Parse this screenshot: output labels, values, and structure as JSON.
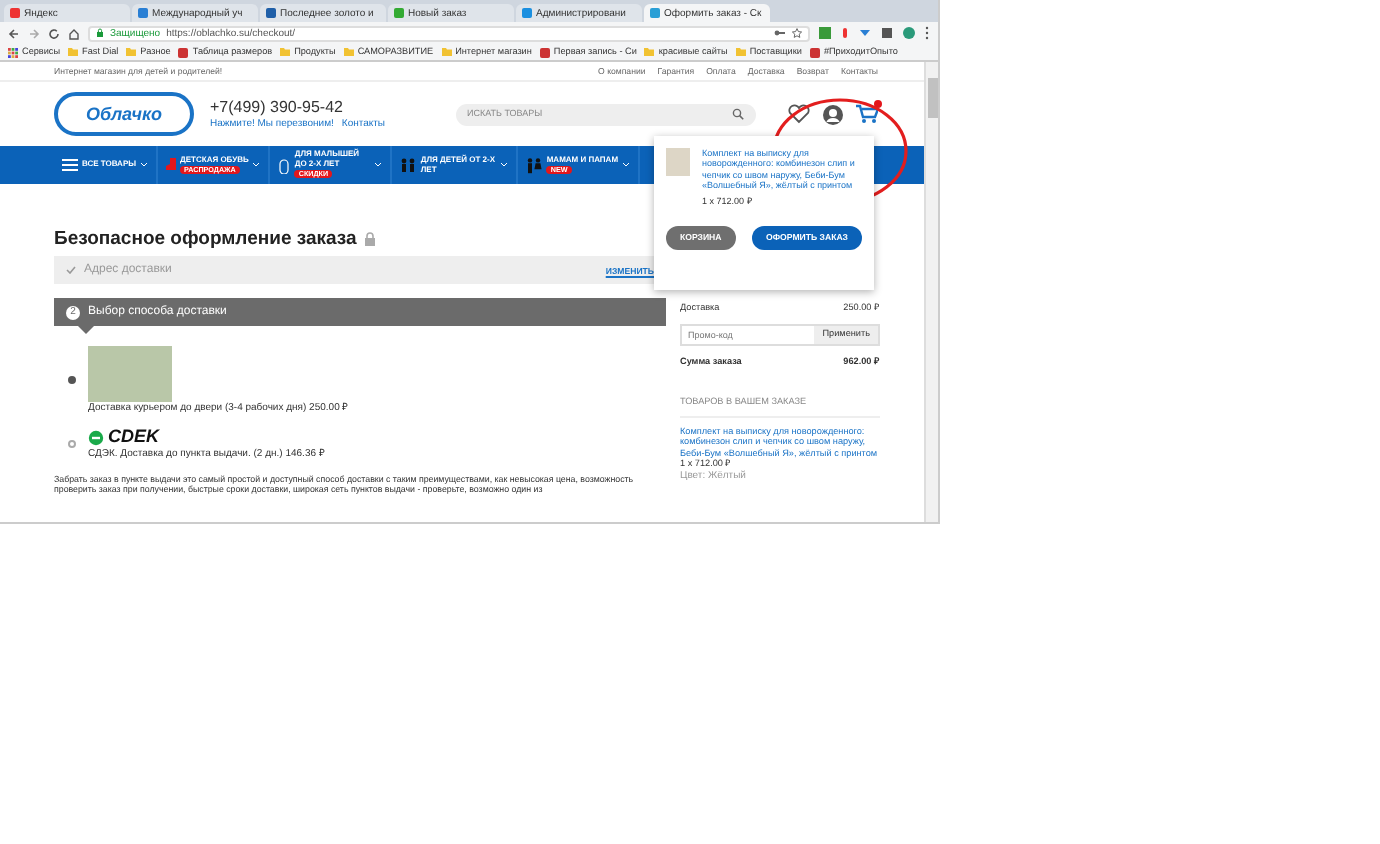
{
  "browser": {
    "tabs": [
      {
        "label": "Яндекс",
        "selected": false
      },
      {
        "label": "Международный уч",
        "selected": false
      },
      {
        "label": "Последнее золото и",
        "selected": false
      },
      {
        "label": "Новый заказ",
        "selected": false
      },
      {
        "label": "Администрировани",
        "selected": false
      },
      {
        "label": "Оформить заказ - Ск",
        "selected": true
      }
    ],
    "secure_label": "Защищено",
    "url": "https://oblachko.su/checkout/",
    "bookmarks": [
      {
        "label": "Сервисы",
        "kind": "apps"
      },
      {
        "label": "Fast Dial",
        "kind": "folder"
      },
      {
        "label": "Разное",
        "kind": "folder"
      },
      {
        "label": "Таблица размеров",
        "kind": "site"
      },
      {
        "label": "Продукты",
        "kind": "folder"
      },
      {
        "label": "САМОРАЗВИТИЕ",
        "kind": "folder"
      },
      {
        "label": "Интернет магазин",
        "kind": "folder"
      },
      {
        "label": "Первая запись - Си",
        "kind": "site"
      },
      {
        "label": "красивые сайты",
        "kind": "folder"
      },
      {
        "label": "Поставщики",
        "kind": "folder"
      },
      {
        "label": "#ПриходитОпыто",
        "kind": "site"
      }
    ]
  },
  "site": {
    "tagline": "Интернет магазин для детей и родителей!",
    "top_links": [
      "О компании",
      "Гарантия",
      "Оплата",
      "Доставка",
      "Возврат",
      "Контакты"
    ],
    "logo": "Облачко",
    "phone": "+7(499) 390-95-42",
    "callback": "Нажмите! Мы перезвоним!",
    "contacts": "Контакты",
    "search": {
      "placeholder": "ИСКАТЬ ТОВАРЫ"
    },
    "nav": [
      {
        "label": "ВСЕ ТОВАРЫ",
        "kind": "menu"
      },
      {
        "label": "ДЕТСКАЯ ОБУВЬ",
        "badge": "РАСПРОДАЖА",
        "kind": "boot"
      },
      {
        "label": "ДЛЯ МАЛЫШЕЙ ДО 2-Х ЛЕТ",
        "badge": "СКИДКИ",
        "kind": "bottle"
      },
      {
        "label": "ДЛЯ ДЕТЕЙ ОТ 2-Х ЛЕТ",
        "kind": "kids"
      },
      {
        "label": "МАМАМ И ПАПАМ",
        "badge": "NEW",
        "kind": "parents"
      }
    ]
  },
  "checkout": {
    "title": "Безопасное оформление заказа",
    "address_step": {
      "label": "Адрес доставки",
      "action": "ИЗМЕНИТЬ"
    },
    "delivery_step": {
      "number": "2",
      "label": "Выбор способа доставки"
    },
    "options": [
      {
        "kind": "courier",
        "label": "Доставка курьером до двери (3-4 рабочих дня) 250.00 ₽",
        "selected": true
      },
      {
        "kind": "cdek",
        "logo": "CDEK",
        "label": "СДЭК. Доставка до пункта выдачи. (2 дн.) 146.36 ₽",
        "selected": false
      }
    ],
    "description": "Забрать заказ в пункте выдачи это самый простой и доступный способ доставки с таким преимуществами, как невысокая цена, возможность проверить заказ при получении, быстрые сроки доставки, широкая сеть пунктов выдачи - проверьте, возможно один из"
  },
  "summary": {
    "delivery_label": "Доставка",
    "delivery_value": "250.00 ₽",
    "promo": {
      "placeholder": "Промо-код",
      "button": "Применить"
    },
    "total_label": "Сумма заказа",
    "total_value": "962.00 ₽",
    "items_heading": "ТОВАРОВ В ВАШЕМ ЗАКАЗЕ",
    "item": {
      "name": "Комплект на выписку для новорожденного: комбинезон слип и чепчик со швом наружу, Беби-Бум «Волшебный Я», жёлтый с принтом",
      "qty": "1 x 712.00 ₽",
      "color_label": "Цвет: Жёлтый"
    }
  },
  "cart_popup": {
    "item": {
      "name": "Комплект на выписку для новорожденного: комбинезон слип и чепчик со швом наружу, Беби-Бум «Волшебный Я», жёлтый с принтом",
      "qty": "1 x 712.00 ₽"
    },
    "buttons": [
      {
        "label": "КОРЗИНА",
        "kind": "secondary"
      },
      {
        "label": "ОФОРМИТЬ ЗАКАЗ",
        "kind": "primary"
      }
    ]
  }
}
